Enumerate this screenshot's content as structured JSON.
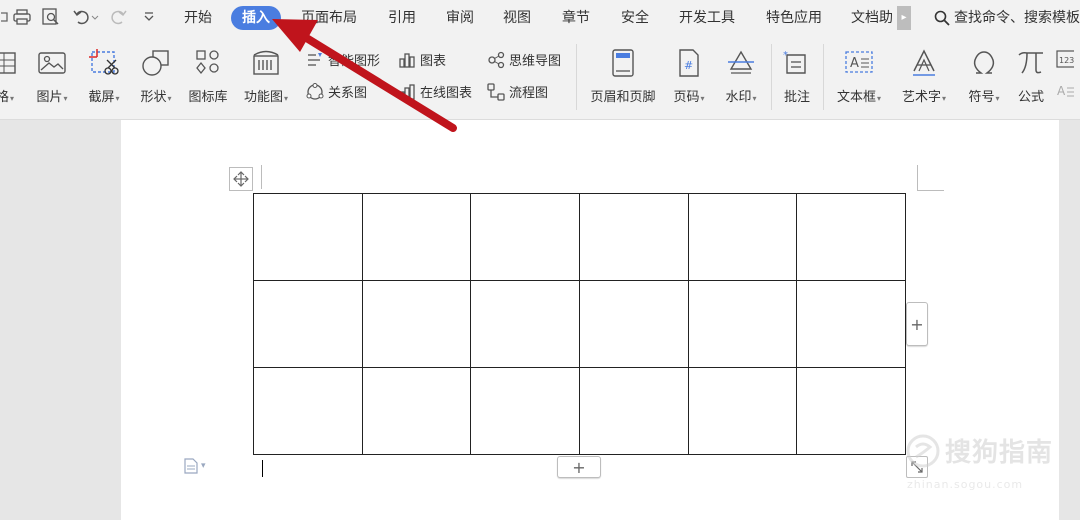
{
  "menu": {
    "tabs": [
      "开始",
      "插入",
      "页面布局",
      "引用",
      "审阅",
      "视图",
      "章节",
      "安全",
      "开发工具",
      "特色应用",
      "文档助"
    ],
    "active_tab": "插入",
    "search_label": "查找命令、搜索模板"
  },
  "ribbon": {
    "big_tools": [
      {
        "label": "格",
        "icon": "table-icon",
        "has_dropdown": true
      },
      {
        "label": "图片",
        "icon": "picture-icon",
        "has_dropdown": true
      },
      {
        "label": "截屏",
        "icon": "screenshot-icon",
        "has_dropdown": true
      },
      {
        "label": "形状",
        "icon": "shape-icon",
        "has_dropdown": true
      },
      {
        "label": "图标库",
        "icon": "icon-library-icon",
        "has_dropdown": false
      },
      {
        "label": "功能图",
        "icon": "function-chart-icon",
        "has_dropdown": true
      },
      {
        "label": "页眉和页脚",
        "icon": "header-footer-icon",
        "has_dropdown": false
      },
      {
        "label": "页码",
        "icon": "page-number-icon",
        "has_dropdown": true
      },
      {
        "label": "水印",
        "icon": "watermark-icon",
        "has_dropdown": true
      },
      {
        "label": "批注",
        "icon": "comment-icon",
        "has_dropdown": false
      },
      {
        "label": "文本框",
        "icon": "textbox-icon",
        "has_dropdown": true
      },
      {
        "label": "艺术字",
        "icon": "wordart-icon",
        "has_dropdown": true
      },
      {
        "label": "符号",
        "icon": "omega-icon",
        "has_dropdown": true
      },
      {
        "label": "公式",
        "icon": "pi-icon",
        "has_dropdown": false
      }
    ],
    "small_tools": [
      {
        "label": "智能图形",
        "icon": "smart-graphic-icon"
      },
      {
        "label": "关系图",
        "icon": "relation-chart-icon"
      },
      {
        "label": "图表",
        "icon": "chart-icon"
      },
      {
        "label": "在线图表",
        "icon": "online-chart-icon"
      },
      {
        "label": "思维导图",
        "icon": "mind-map-icon"
      },
      {
        "label": "流程图",
        "icon": "flowchart-icon"
      }
    ]
  },
  "document": {
    "table_rows": 3,
    "table_cols": 6,
    "add_label": "+"
  },
  "watermark_text": "搜狗指南",
  "watermark_sub": "zhinan.sogou.com",
  "colors": {
    "active_tab": "#4a7de0",
    "arrow": "#c0141c",
    "ribbon_bg": "#f2f2f2",
    "canvas_bg": "#e6e6e6"
  }
}
